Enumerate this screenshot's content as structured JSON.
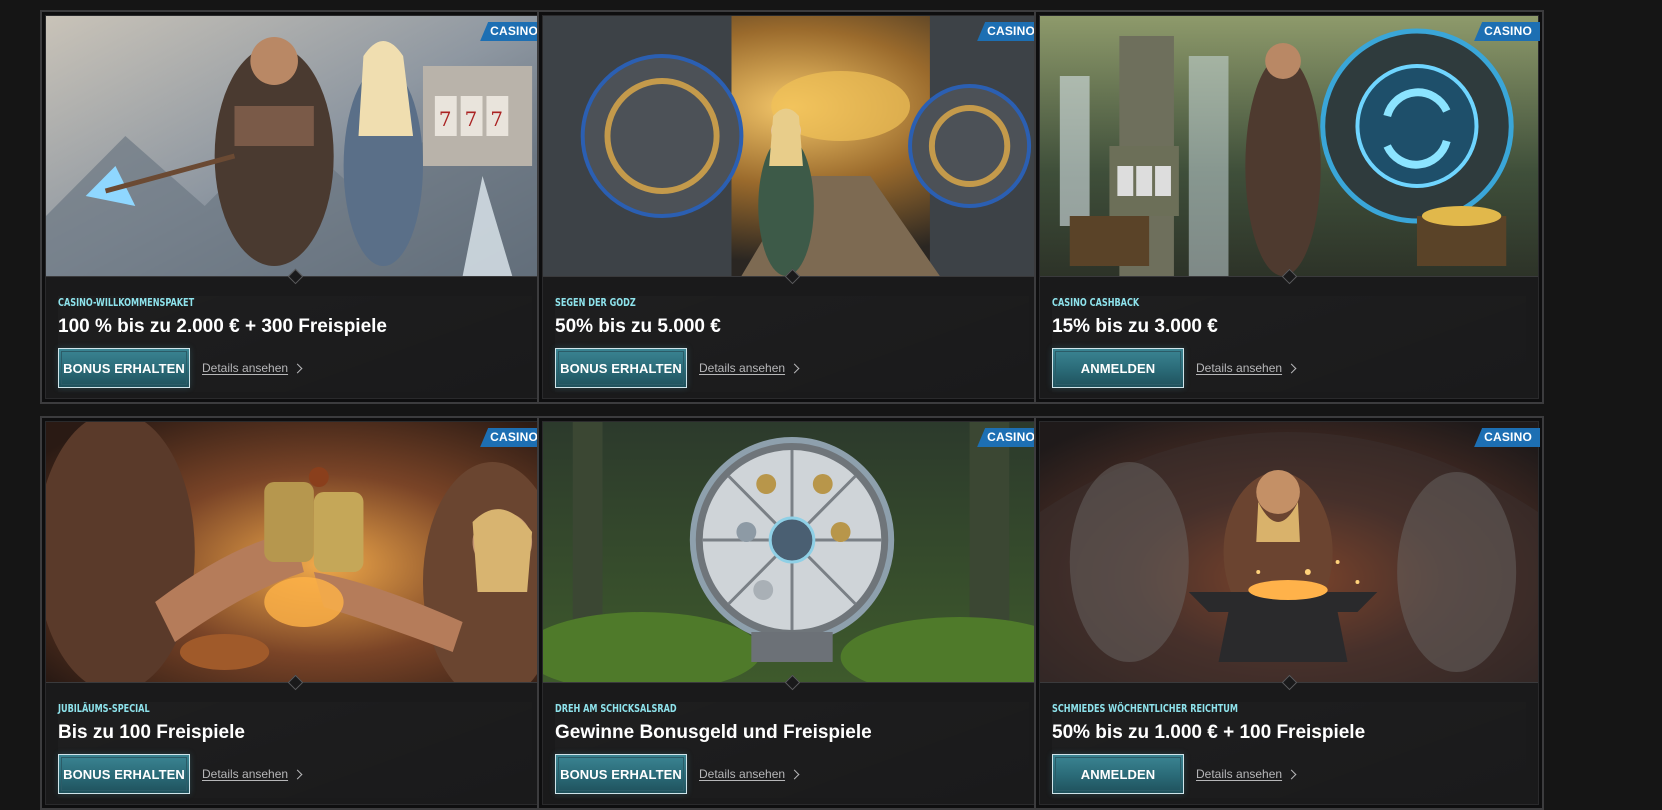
{
  "cards": [
    {
      "badge": "CASINO",
      "category": "Casino-Willkommenspaket",
      "title": "100 % bis zu 2.000 € + 300 Freispiele",
      "cta": "BONUS ERHALTEN",
      "details": "Details ansehen",
      "image_icon": "viking-warriors-slot-machine-illustration"
    },
    {
      "badge": "CASINO",
      "category": "Segen der Godz",
      "title": "50% bis zu 5.000 €",
      "cta": "BONUS ERHALTEN",
      "details": "Details ansehen",
      "image_icon": "treasure-vault-door-illustration"
    },
    {
      "badge": "CASINO",
      "category": "Casino Cashback",
      "title": "15% bis zu 3.000 €",
      "cta": "ANMELDEN",
      "details": "Details ansehen",
      "image_icon": "rune-portal-cashback-illustration"
    },
    {
      "badge": "CASINO",
      "category": "Jubiläums-Special",
      "title": "Bis zu 100 Freispiele",
      "cta": "BONUS ERHALTEN",
      "details": "Details ansehen",
      "image_icon": "feast-toast-illustration"
    },
    {
      "badge": "CASINO",
      "category": "Dreh am Schicksalsrad",
      "title": "Gewinne Bonusgeld und Freispiele",
      "cta": "BONUS ERHALTEN",
      "details": "Details ansehen",
      "image_icon": "fortune-wheel-illustration"
    },
    {
      "badge": "CASINO",
      "category": "Schmiedes wöchentlicher Reichtum",
      "title": "50% bis zu 1.000 € + 100 Freispiele",
      "cta": "ANMELDEN",
      "details": "Details ansehen",
      "image_icon": "dwarf-forge-illustration"
    }
  ],
  "colors": {
    "background": "#151515",
    "badge": "#1d6fb3",
    "category": "#8ee3ec",
    "button": "#2a6a77"
  }
}
